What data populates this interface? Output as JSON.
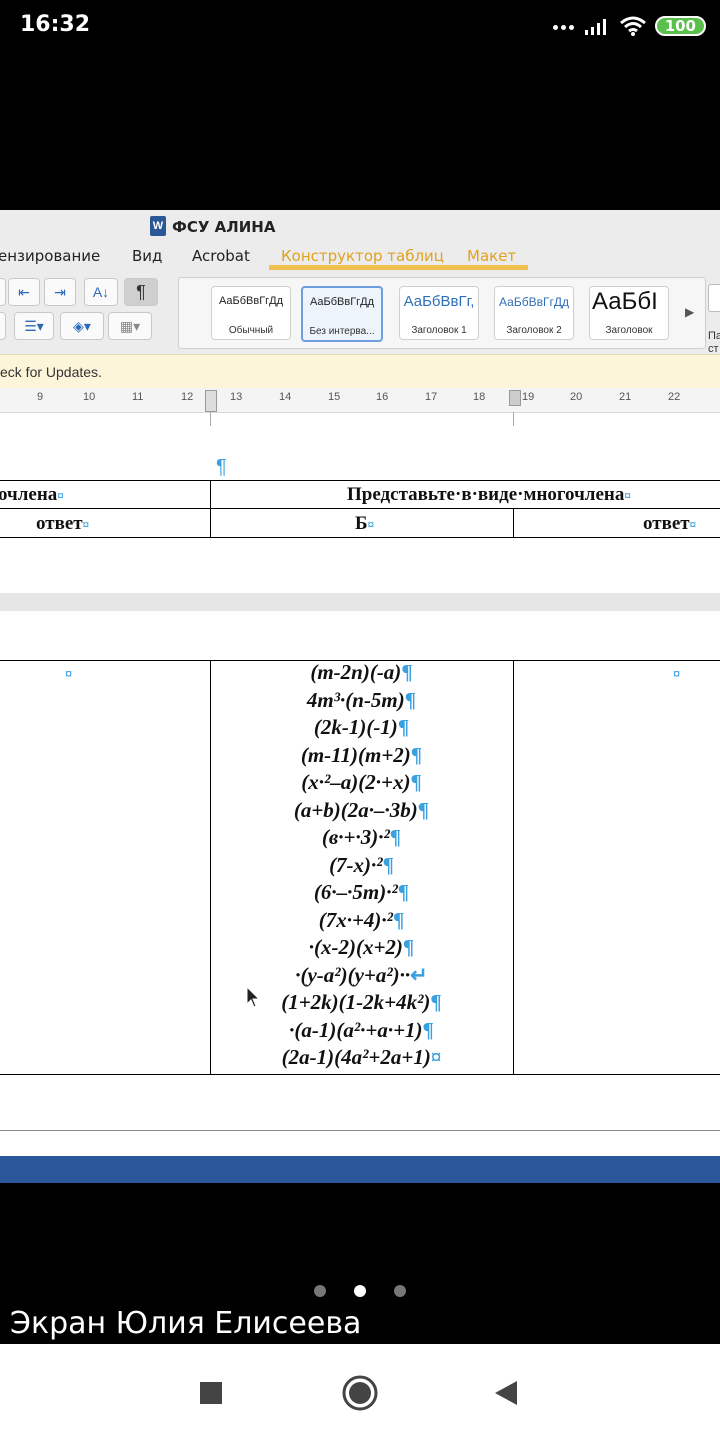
{
  "status_bar": {
    "time": "16:32",
    "battery": "100"
  },
  "window": {
    "title": "ФСУ АЛИНА",
    "app_badge": "W"
  },
  "ribbon_tabs": [
    "ензирование",
    "Вид",
    "Acrobat",
    "Конструктор таблиц",
    "Макет"
  ],
  "toolbar": {
    "pilcrow": "¶"
  },
  "styles": [
    {
      "preview": "АаБбВвГгДд",
      "name": "Обычный"
    },
    {
      "preview": "АаБбВвГгДд",
      "name": "Без интерва..."
    },
    {
      "preview": "АаБбВвГг,",
      "name": "Заголовок 1"
    },
    {
      "preview": "АаБбВвГгДд",
      "name": "Заголовок 2"
    },
    {
      "preview": "АаБбІ",
      "name": "Заголовок"
    }
  ],
  "styles_pane_label": "Па ст",
  "update_bar": {
    "text": "eck for Updates."
  },
  "ruler": {
    "numbers": [
      "9",
      "10",
      "11",
      "12",
      "13",
      "14",
      "15",
      "16",
      "17",
      "18",
      "19",
      "20",
      "21",
      "22"
    ]
  },
  "table1": {
    "header_left": "очлена",
    "header_right": "Представьте·в·виде·многочлена",
    "sub_left": "ответ",
    "sub_mid": "Б",
    "sub_right": "ответ",
    "cell_mark": "¤",
    "paragraph_mark": "¶"
  },
  "table2": {
    "cell_mark": "¤",
    "expressions": [
      "(m-2n)(-a)",
      "4m³·(n-5m)",
      "(2k-1)(-1)",
      "(m-11)(m+2)",
      "(x·²–a)(2·+x)",
      "(a+b)(2a·–·3b)",
      "(в·+·3)·²",
      "(7-x)·²",
      "(6·–·5m)·²",
      "(7x·+4)·²",
      "·(x-2)(x+2)",
      "·(y-a²)(y+a²)··",
      "(1+2k)(1-2k+4k²)",
      "·(a-1)(a²·+a·+1)",
      "(2a-1)(4a²+2a+1)"
    ],
    "endings": [
      "¶",
      "¶",
      "¶",
      "¶",
      "¶",
      "¶",
      "¶",
      "¶",
      "¶",
      "¶",
      "¶",
      "↵",
      "¶",
      "¶",
      "¤"
    ]
  },
  "share_label": "Экран Юлия Елисеева"
}
